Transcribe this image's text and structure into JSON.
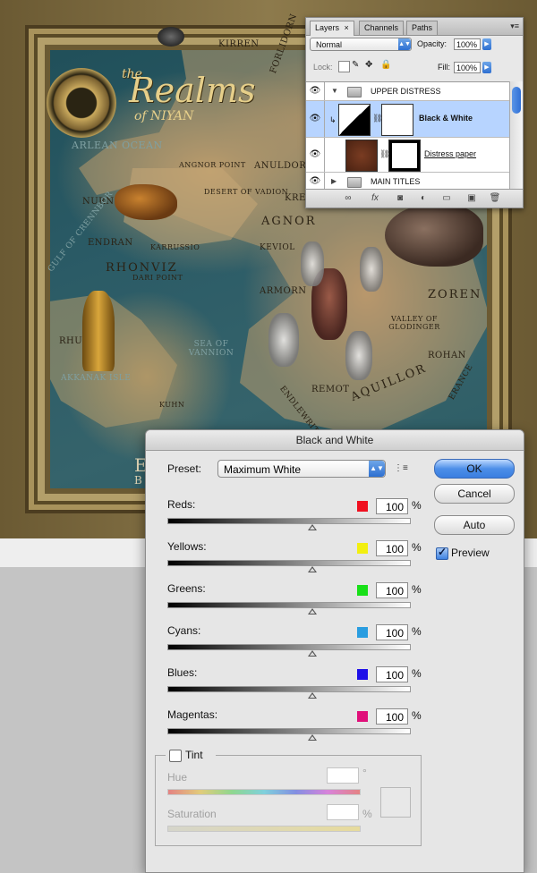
{
  "map": {
    "title_line1": "the",
    "title_line2": "Realms",
    "title_line3": "of NIYAN",
    "labels": [
      {
        "text": "KIRREN",
        "cls": ""
      },
      {
        "text": "FORLIDORN",
        "cls": ""
      },
      {
        "text": "ARLEAN OCEAN",
        "cls": "sea"
      },
      {
        "text": "ANGNOR POINT",
        "cls": ""
      },
      {
        "text": "DESERT OF VADION",
        "cls": ""
      },
      {
        "text": "ANULDOR",
        "cls": ""
      },
      {
        "text": "KRELAC",
        "cls": ""
      },
      {
        "text": "NURN",
        "cls": ""
      },
      {
        "text": "AGNOR",
        "cls": "big"
      },
      {
        "text": "ENDRAN",
        "cls": ""
      },
      {
        "text": "KARRUSSIO",
        "cls": ""
      },
      {
        "text": "KEVIOL",
        "cls": ""
      },
      {
        "text": "GULF OF CRENNBOR",
        "cls": "sea"
      },
      {
        "text": "RHONVIZ",
        "cls": "big"
      },
      {
        "text": "DARI POINT",
        "cls": ""
      },
      {
        "text": "ZOREN",
        "cls": "big"
      },
      {
        "text": "ARMORN",
        "cls": ""
      },
      {
        "text": "VALLEY OF GLODINGER",
        "cls": ""
      },
      {
        "text": "RHUNA",
        "cls": ""
      },
      {
        "text": "SEA OF VANNION",
        "cls": "sea"
      },
      {
        "text": "ROHAN",
        "cls": ""
      },
      {
        "text": "AKKANAK ISLE",
        "cls": "sea"
      },
      {
        "text": "REMOT",
        "cls": ""
      },
      {
        "text": "AQUILLOR",
        "cls": "big"
      },
      {
        "text": "KUHN",
        "cls": ""
      },
      {
        "text": "ENDLEWRITH",
        "cls": ""
      },
      {
        "text": "ERANCE",
        "cls": ""
      }
    ],
    "corner_text_1": "E",
    "corner_text_2": "B"
  },
  "layers_panel": {
    "tabs": [
      "Layers",
      "Channels",
      "Paths"
    ],
    "tab_close": "×",
    "blend_mode": "Normal",
    "opacity_label": "Opacity:",
    "opacity_value": "100%",
    "lock_label": "Lock:",
    "fill_label": "Fill:",
    "fill_value": "100%",
    "layers": [
      {
        "name": "UPPER DISTRESS",
        "type": "group-open"
      },
      {
        "name": "Black & White",
        "type": "adjustment",
        "selected": true
      },
      {
        "name": "Distress paper",
        "type": "pixel"
      },
      {
        "name": "MAIN TITLES",
        "type": "group-closed"
      }
    ],
    "eye": "👁",
    "bottom_icons": [
      "link-icon",
      "fx-icon",
      "mask-icon",
      "adjustment-icon",
      "folder-icon",
      "new-layer-icon",
      "trash-icon"
    ],
    "bottom_glyphs": [
      "∞",
      "fx",
      "◙",
      "◐",
      "▭",
      "▣",
      "🗑"
    ]
  },
  "bw_dialog": {
    "title": "Black and White",
    "preset_label": "Preset:",
    "preset_value": "Maximum White",
    "ok": "OK",
    "cancel": "Cancel",
    "auto": "Auto",
    "preview_label": "Preview",
    "preview_checked": true,
    "percent": "%",
    "sliders": [
      {
        "label": "Reds:",
        "value": "100",
        "color": "#f01020"
      },
      {
        "label": "Yellows:",
        "value": "100",
        "color": "#f2ef10"
      },
      {
        "label": "Greens:",
        "value": "100",
        "color": "#18e018"
      },
      {
        "label": "Cyans:",
        "value": "100",
        "color": "#2a9de0"
      },
      {
        "label": "Blues:",
        "value": "100",
        "color": "#1e10e8"
      },
      {
        "label": "Magentas:",
        "value": "100",
        "color": "#e0107a"
      }
    ],
    "slider_position": 0.6,
    "tint_label": "Tint",
    "tint_checked": false,
    "hue_label": "Hue",
    "hue_unit": "°",
    "saturation_label": "Saturation",
    "saturation_unit": "%"
  }
}
